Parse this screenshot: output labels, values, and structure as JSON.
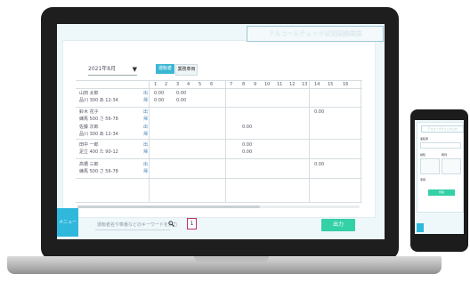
{
  "app": {
    "title": "アルコールチェック状況確認画面",
    "dropdown_value": "2021年8月",
    "tabs": [
      "運転者",
      "業務車両"
    ],
    "search_placeholder": "運転者名や車番などのキーワードを入力",
    "page_number": "1",
    "output_button": "出力",
    "menu_button": "メニュー"
  },
  "table": {
    "days": [
      "1",
      "2",
      "3",
      "4",
      "5",
      "6",
      "7",
      "8",
      "9",
      "10",
      "11",
      "12",
      "13",
      "14",
      "15",
      "16"
    ],
    "rows": [
      {
        "name": "山田 太郎",
        "sub": "品川 300 あ 12-34",
        "marks": [
          "出",
          "帰"
        ],
        "values": [
          "0.00",
          "0.00"
        ]
      },
      {
        "name": "",
        "sub": "",
        "marks": [
          "",
          "帰"
        ],
        "values": [
          "0.00",
          "0.00"
        ]
      },
      {
        "name": "鈴木 花子",
        "sub": "練馬 500 さ 56-78",
        "marks": [
          "出",
          "帰"
        ],
        "values": [
          "0.00"
        ]
      },
      {
        "name": "佐藤 次郎",
        "sub": "品川 300 あ 12-34",
        "marks": [
          "出",
          "帰"
        ],
        "values": [
          "0.00"
        ]
      },
      {
        "name": "田中 一郎",
        "sub": "足立 400 た 90-12",
        "marks": [
          "出",
          "帰"
        ],
        "values": [
          "0.00",
          "0.00"
        ]
      },
      {
        "name": "高橋 三郎",
        "sub": "練馬 500 さ 56-78",
        "marks": [
          "出",
          "帰"
        ],
        "values": [
          "0.00"
        ]
      }
    ]
  },
  "phone": {
    "title": "アルコールチェック入力",
    "label_driver": "運転者",
    "label_vehicle": "車両",
    "label_alcohol": "検知",
    "label_time": "時刻",
    "button": "登録"
  },
  "colors": {
    "accent": "#3bb6d3",
    "output_button": "#34d0a6",
    "page_box_border": "#c0306a"
  }
}
